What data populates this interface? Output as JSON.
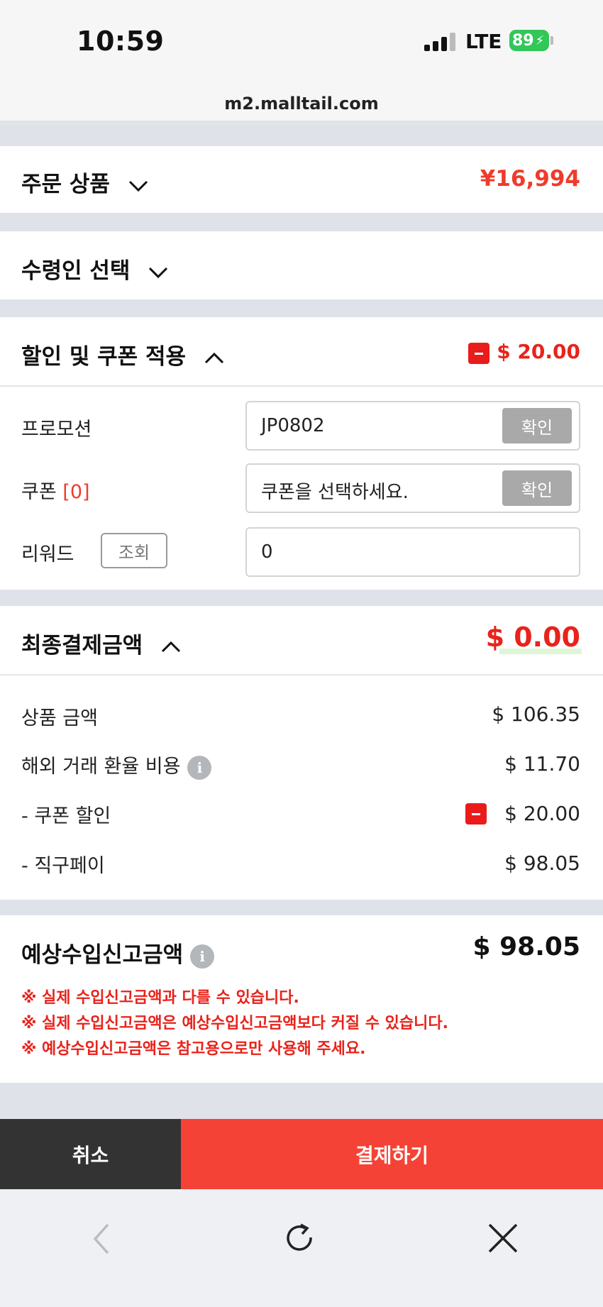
{
  "status": {
    "time": "10:59",
    "network": "LTE",
    "battery": "89"
  },
  "browser": {
    "url": "m2.malltail.com"
  },
  "order_items": {
    "title": "주문 상품",
    "amount": "¥16,994"
  },
  "recipient": {
    "title": "수령인 선택"
  },
  "discount": {
    "title": "할인 및 쿠폰 적용",
    "amount": "$ 20.00",
    "promotion": {
      "label": "프로모션",
      "value": "JP0802",
      "button": "확인"
    },
    "coupon": {
      "label": "쿠폰",
      "count": "[0]",
      "placeholder": "쿠폰을 선택하세요.",
      "button": "확인"
    },
    "reward": {
      "label": "리워드",
      "lookup_button": "조회",
      "value": "0"
    }
  },
  "final_payment": {
    "title": "최종결제금액",
    "amount": "$ 0.00",
    "rows": [
      {
        "label": "상품 금액",
        "value": "$ 106.35"
      },
      {
        "label": "해외 거래 환율 비용",
        "value": "$ 11.70"
      },
      {
        "label": "- 쿠폰 할인",
        "value": "$ 20.00"
      },
      {
        "label": "- 직구페이",
        "value": "$ 98.05"
      }
    ]
  },
  "import_declaration": {
    "title": "예상수입신고금액",
    "amount": "$ 98.05",
    "notices": [
      "※ 실제 수입신고금액과 다를 수 있습니다.",
      "※ 실제 수입신고금액은 예상수입신고금액보다 커질 수 있습니다.",
      "※ 예상수입신고금액은 참고용으로만 사용해 주세요."
    ]
  },
  "actions": {
    "cancel": "취소",
    "pay": "결제하기"
  },
  "nav_icons": [
    "back-icon",
    "reload-icon",
    "close-icon"
  ],
  "colors": {
    "accent": "#f44336",
    "minus": "#ea1b1b",
    "dark": "#333333"
  }
}
